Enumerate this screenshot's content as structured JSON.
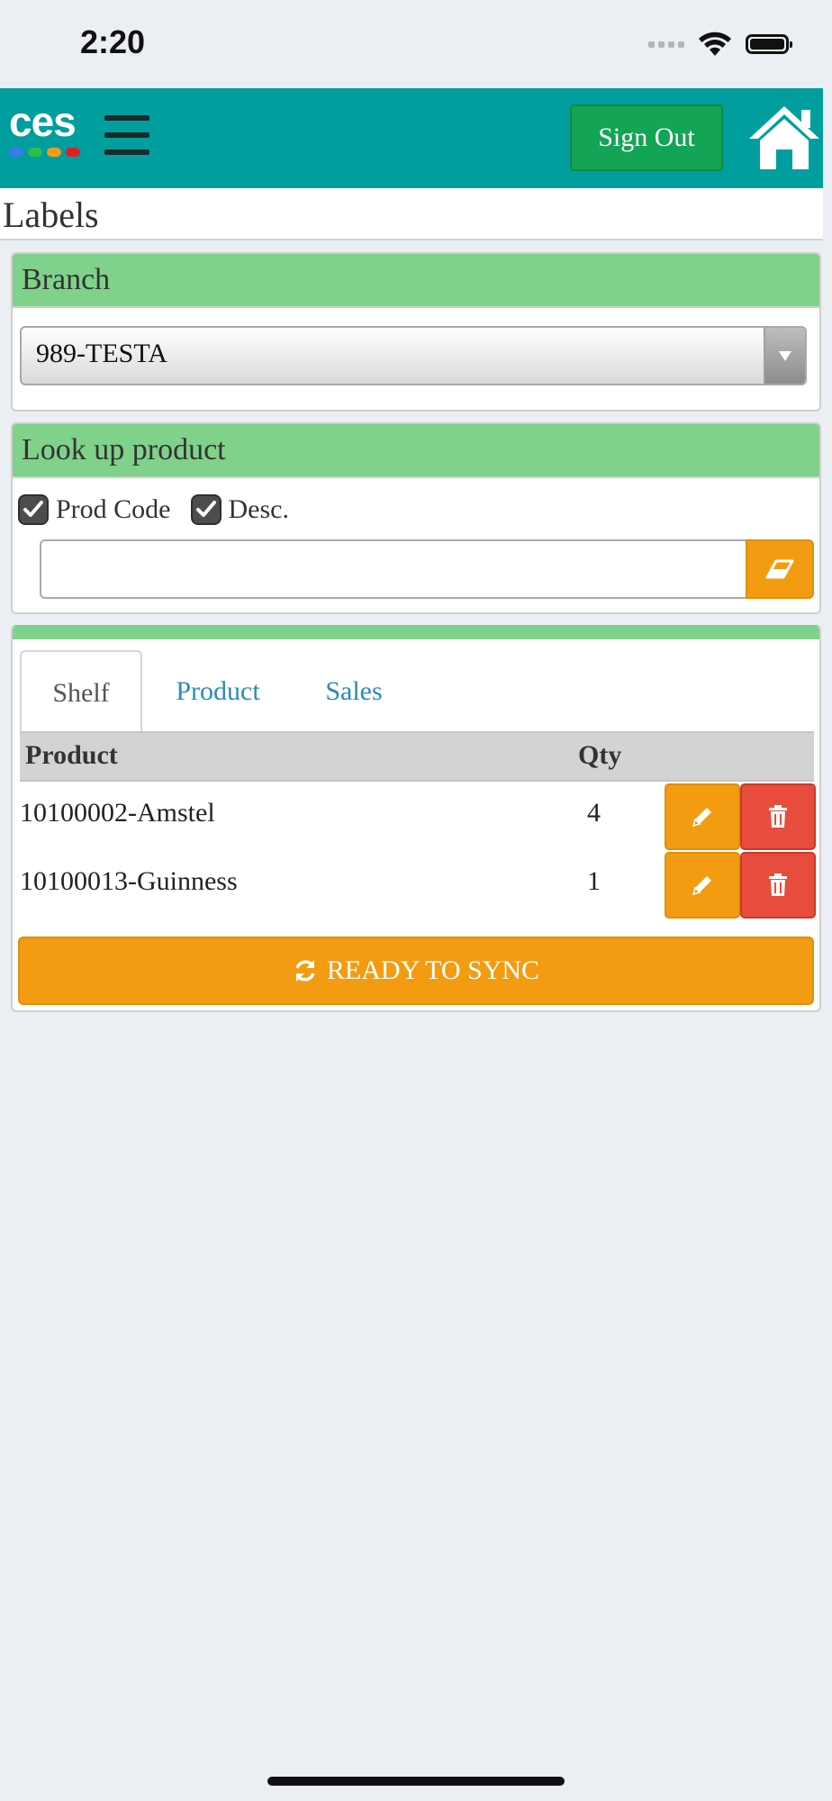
{
  "status_bar": {
    "time": "2:20"
  },
  "header": {
    "logo_text": "ces",
    "logo_dot_colors": [
      "#3b7bf0",
      "#2ebd4a",
      "#f39c12",
      "#e02020"
    ],
    "signout_label": "Sign Out"
  },
  "page": {
    "title": "Labels"
  },
  "branch": {
    "heading": "Branch",
    "selected": "989-TESTA"
  },
  "lookup": {
    "heading": "Look up product",
    "checkbox_prod_code": "Prod Code",
    "checkbox_desc": "Desc.",
    "prod_code_checked": true,
    "desc_checked": true,
    "search_value": "",
    "search_placeholder": ""
  },
  "tabs": {
    "items": [
      {
        "label": "Shelf",
        "active": true
      },
      {
        "label": "Product",
        "active": false
      },
      {
        "label": "Sales",
        "active": false
      }
    ]
  },
  "table": {
    "columns": [
      "Product",
      "Qty"
    ],
    "rows": [
      {
        "product": "10100002-Amstel",
        "qty": "4"
      },
      {
        "product": "10100013-Guinness",
        "qty": "1"
      }
    ]
  },
  "sync": {
    "label": "READY TO SYNC"
  },
  "colors": {
    "header_bg": "#009e9e",
    "panel_head_bg": "#80d18a",
    "signout_bg": "#14a456",
    "warning": "#f39c12",
    "danger": "#e74c3c",
    "link": "#2a8ab8"
  }
}
